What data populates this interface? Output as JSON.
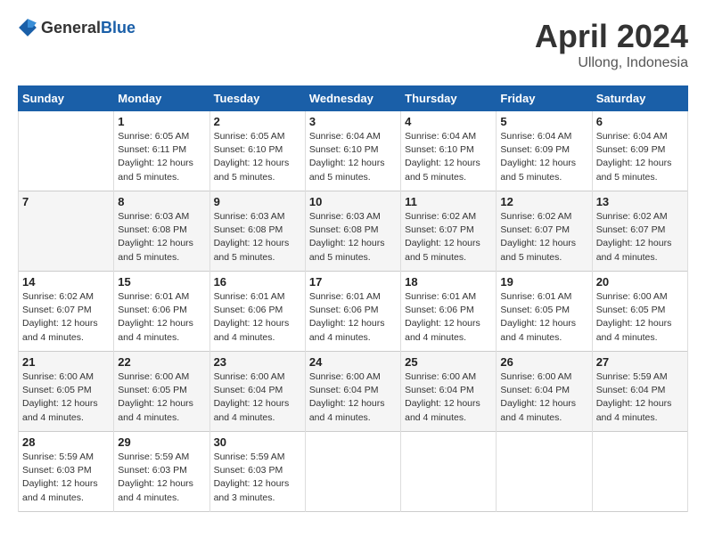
{
  "header": {
    "logo_general": "General",
    "logo_blue": "Blue",
    "month_year": "April 2024",
    "location": "Ullong, Indonesia"
  },
  "days_of_week": [
    "Sunday",
    "Monday",
    "Tuesday",
    "Wednesday",
    "Thursday",
    "Friday",
    "Saturday"
  ],
  "weeks": [
    [
      {
        "day": "",
        "info": ""
      },
      {
        "day": "1",
        "info": "Sunrise: 6:05 AM\nSunset: 6:11 PM\nDaylight: 12 hours\nand 5 minutes."
      },
      {
        "day": "2",
        "info": "Sunrise: 6:05 AM\nSunset: 6:10 PM\nDaylight: 12 hours\nand 5 minutes."
      },
      {
        "day": "3",
        "info": "Sunrise: 6:04 AM\nSunset: 6:10 PM\nDaylight: 12 hours\nand 5 minutes."
      },
      {
        "day": "4",
        "info": "Sunrise: 6:04 AM\nSunset: 6:10 PM\nDaylight: 12 hours\nand 5 minutes."
      },
      {
        "day": "5",
        "info": "Sunrise: 6:04 AM\nSunset: 6:09 PM\nDaylight: 12 hours\nand 5 minutes."
      },
      {
        "day": "6",
        "info": "Sunrise: 6:04 AM\nSunset: 6:09 PM\nDaylight: 12 hours\nand 5 minutes."
      }
    ],
    [
      {
        "day": "7",
        "info": ""
      },
      {
        "day": "8",
        "info": "Sunrise: 6:03 AM\nSunset: 6:08 PM\nDaylight: 12 hours\nand 5 minutes."
      },
      {
        "day": "9",
        "info": "Sunrise: 6:03 AM\nSunset: 6:08 PM\nDaylight: 12 hours\nand 5 minutes."
      },
      {
        "day": "10",
        "info": "Sunrise: 6:03 AM\nSunset: 6:08 PM\nDaylight: 12 hours\nand 5 minutes."
      },
      {
        "day": "11",
        "info": "Sunrise: 6:02 AM\nSunset: 6:07 PM\nDaylight: 12 hours\nand 5 minutes."
      },
      {
        "day": "12",
        "info": "Sunrise: 6:02 AM\nSunset: 6:07 PM\nDaylight: 12 hours\nand 5 minutes."
      },
      {
        "day": "13",
        "info": "Sunrise: 6:02 AM\nSunset: 6:07 PM\nDaylight: 12 hours\nand 4 minutes."
      }
    ],
    [
      {
        "day": "14",
        "info": "Sunrise: 6:02 AM\nSunset: 6:07 PM\nDaylight: 12 hours\nand 4 minutes."
      },
      {
        "day": "15",
        "info": "Sunrise: 6:01 AM\nSunset: 6:06 PM\nDaylight: 12 hours\nand 4 minutes."
      },
      {
        "day": "16",
        "info": "Sunrise: 6:01 AM\nSunset: 6:06 PM\nDaylight: 12 hours\nand 4 minutes."
      },
      {
        "day": "17",
        "info": "Sunrise: 6:01 AM\nSunset: 6:06 PM\nDaylight: 12 hours\nand 4 minutes."
      },
      {
        "day": "18",
        "info": "Sunrise: 6:01 AM\nSunset: 6:06 PM\nDaylight: 12 hours\nand 4 minutes."
      },
      {
        "day": "19",
        "info": "Sunrise: 6:01 AM\nSunset: 6:05 PM\nDaylight: 12 hours\nand 4 minutes."
      },
      {
        "day": "20",
        "info": "Sunrise: 6:00 AM\nSunset: 6:05 PM\nDaylight: 12 hours\nand 4 minutes."
      }
    ],
    [
      {
        "day": "21",
        "info": "Sunrise: 6:00 AM\nSunset: 6:05 PM\nDaylight: 12 hours\nand 4 minutes."
      },
      {
        "day": "22",
        "info": "Sunrise: 6:00 AM\nSunset: 6:05 PM\nDaylight: 12 hours\nand 4 minutes."
      },
      {
        "day": "23",
        "info": "Sunrise: 6:00 AM\nSunset: 6:04 PM\nDaylight: 12 hours\nand 4 minutes."
      },
      {
        "day": "24",
        "info": "Sunrise: 6:00 AM\nSunset: 6:04 PM\nDaylight: 12 hours\nand 4 minutes."
      },
      {
        "day": "25",
        "info": "Sunrise: 6:00 AM\nSunset: 6:04 PM\nDaylight: 12 hours\nand 4 minutes."
      },
      {
        "day": "26",
        "info": "Sunrise: 6:00 AM\nSunset: 6:04 PM\nDaylight: 12 hours\nand 4 minutes."
      },
      {
        "day": "27",
        "info": "Sunrise: 5:59 AM\nSunset: 6:04 PM\nDaylight: 12 hours\nand 4 minutes."
      }
    ],
    [
      {
        "day": "28",
        "info": "Sunrise: 5:59 AM\nSunset: 6:03 PM\nDaylight: 12 hours\nand 4 minutes."
      },
      {
        "day": "29",
        "info": "Sunrise: 5:59 AM\nSunset: 6:03 PM\nDaylight: 12 hours\nand 4 minutes."
      },
      {
        "day": "30",
        "info": "Sunrise: 5:59 AM\nSunset: 6:03 PM\nDaylight: 12 hours\nand 3 minutes."
      },
      {
        "day": "",
        "info": ""
      },
      {
        "day": "",
        "info": ""
      },
      {
        "day": "",
        "info": ""
      },
      {
        "day": "",
        "info": ""
      }
    ]
  ]
}
